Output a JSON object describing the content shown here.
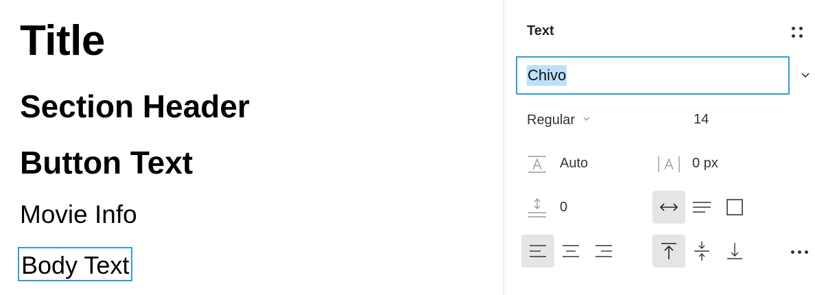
{
  "canvas": {
    "styles": [
      {
        "label": "Title"
      },
      {
        "label": "Section Header"
      },
      {
        "label": "Button Text"
      },
      {
        "label": "Movie Info"
      },
      {
        "label": "Body Text",
        "selected": true
      }
    ],
    "selection_color": "#2d9cdb"
  },
  "panel": {
    "section_title": "Text",
    "styles_icon": "style-grid-icon",
    "font_family": {
      "value": "Chivo",
      "focused": true,
      "text_selected": true
    },
    "font_weight": {
      "value": "Regular"
    },
    "font_size": {
      "value": "14"
    },
    "line_height": {
      "value": "Auto",
      "icon": "line-height-icon"
    },
    "letter_spacing": {
      "value": "0 px",
      "icon": "letter-spacing-icon"
    },
    "paragraph_spacing": {
      "value": "0",
      "icon": "paragraph-spacing-icon"
    },
    "resizing": {
      "options": [
        "auto-width",
        "auto-height",
        "fixed-size"
      ],
      "selected": "auto-width"
    },
    "text_align": {
      "options": [
        "left",
        "center",
        "right"
      ],
      "selected": "left"
    },
    "vertical_align": {
      "options": [
        "top",
        "middle",
        "bottom"
      ],
      "selected": "top"
    },
    "more_icon": "more-options-icon"
  },
  "colors": {
    "accent": "#2d9cdb",
    "selection_highlight": "#bde0fb",
    "active_button": "#e5e5e5"
  }
}
